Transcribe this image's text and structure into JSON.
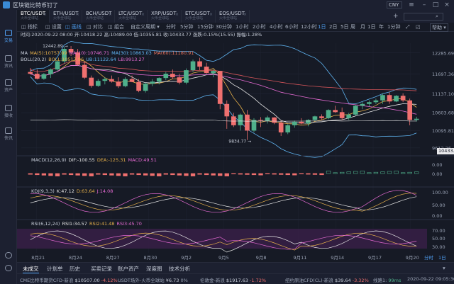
{
  "app": {
    "title": "区块链比特币钉了",
    "currency": "CNY"
  },
  "sidebar": {
    "items": [
      {
        "label": "交易",
        "icon": "trade-icon"
      },
      {
        "label": "资讯",
        "icon": "news-icon"
      },
      {
        "label": "资产",
        "icon": "asset-icon"
      },
      {
        "label": "接收",
        "icon": "receive-icon"
      },
      {
        "label": "快讯",
        "icon": "flash-icon"
      }
    ]
  },
  "pair_tabs": [
    {
      "pair": "BTC/USDT",
      "sub": "火币全球站"
    },
    {
      "pair": "ETH/USDT",
      "sub": "火币全球站"
    },
    {
      "pair": "BCH/USDT",
      "sub": "火币全球站"
    },
    {
      "pair": "LTC/USDT",
      "sub": "火币全球站"
    },
    {
      "pair": "XRP/USDT",
      "sub": "火币全球站"
    },
    {
      "pair": "ETC/USDT",
      "sub": "火币全球站"
    },
    {
      "pair": "EOS/USDT",
      "sub": "火币全球站"
    }
  ],
  "toolbar": {
    "tools": [
      "指标",
      "设置",
      "画线",
      "对比",
      "组合",
      "自定义周期"
    ],
    "periods": [
      "分时",
      "5分钟",
      "15分钟",
      "30分钟",
      "1小时",
      "2小时",
      "4小时",
      "6小时",
      "12小时",
      "1日",
      "2日",
      "5日",
      "周",
      "月",
      "1日",
      "年",
      "1分钟"
    ],
    "active_period": "1日",
    "help": "帮助"
  },
  "chart_data": {
    "type": "candlestick",
    "ohlc_text": "时间:2020-09-22 08:00  开:10418.22  高:10489.00  低:10355.81  收:10433.77  涨跌:0.15%(15.55)  振幅:1.28%",
    "ma_legend": [
      "MA",
      "MA(5):10757.09",
      "MA(10):10746.71",
      "MA(30):10863.03",
      "MA(60):11180.91"
    ],
    "boll_legend": [
      "BOLL(20,2)",
      "BOLL:10517.96",
      "UB:11122.64",
      "LB:9913.27"
    ],
    "y_ticks": [
      "12285.69",
      "11697.36",
      "11137.10",
      "10603.68",
      "10095.81",
      "9612.26"
    ],
    "last_price": "10433.77",
    "high_label": "12442.89",
    "low_label": "9834.77",
    "x_labels": [
      "8月21",
      "8月24",
      "8月27",
      "8月30",
      "9月2",
      "9月5",
      "9月8",
      "9月11",
      "9月14",
      "9月17",
      "9月20"
    ],
    "candles": [
      [
        11750,
        11860,
        11680,
        11700
      ],
      [
        11700,
        11820,
        11540,
        11560
      ],
      [
        11560,
        11720,
        11530,
        11690
      ],
      [
        11690,
        11850,
        11580,
        11820
      ],
      [
        11820,
        12090,
        11780,
        12050
      ],
      [
        12050,
        12460,
        11990,
        12400
      ],
      [
        12400,
        12480,
        12200,
        12300
      ],
      [
        12300,
        12400,
        11920,
        11950
      ],
      [
        11950,
        12050,
        11550,
        11590
      ],
      [
        11590,
        11650,
        11310,
        11360
      ],
      [
        11360,
        11550,
        11330,
        11500
      ],
      [
        11500,
        11600,
        11400,
        11550
      ],
      [
        11550,
        11650,
        11450,
        11480
      ],
      [
        11480,
        11600,
        11300,
        11350
      ],
      [
        11350,
        11600,
        11320,
        11550
      ],
      [
        11550,
        11650,
        11460,
        11470
      ],
      [
        11470,
        11550,
        11180,
        11220
      ],
      [
        11220,
        11450,
        11170,
        11420
      ],
      [
        11420,
        11550,
        11350,
        11480
      ],
      [
        11480,
        11600,
        11400,
        11580
      ],
      [
        11580,
        11750,
        11520,
        11700
      ],
      [
        11700,
        11820,
        11550,
        11600
      ],
      [
        11600,
        11700,
        11400,
        11450
      ],
      [
        11450,
        11850,
        11400,
        11800
      ],
      [
        11800,
        12100,
        11750,
        12050
      ],
      [
        12050,
        12150,
        11800,
        11900
      ],
      [
        11900,
        12010,
        11700,
        11720
      ],
      [
        11720,
        11820,
        11600,
        11780
      ],
      [
        11780,
        11780,
        10700,
        10850
      ],
      [
        10850,
        10950,
        10150,
        10500
      ],
      [
        10500,
        10600,
        10200,
        10250
      ],
      [
        10250,
        10580,
        10100,
        10550
      ],
      [
        10550,
        10680,
        9834,
        10100
      ],
      [
        10100,
        10450,
        10050,
        10400
      ],
      [
        10400,
        10480,
        10200,
        10380
      ],
      [
        10380,
        10520,
        10300,
        10470
      ],
      [
        10470,
        10480,
        10280,
        10320
      ],
      [
        10320,
        10380,
        9950,
        10050
      ],
      [
        10050,
        10280,
        10000,
        10250
      ],
      [
        10250,
        10380,
        10180,
        10350
      ],
      [
        10350,
        10450,
        10280,
        10300
      ],
      [
        10300,
        10420,
        10220,
        10400
      ],
      [
        10400,
        10520,
        10380,
        10500
      ],
      [
        10500,
        10560,
        10400,
        10450
      ],
      [
        10450,
        10700,
        10420,
        10680
      ],
      [
        10680,
        10800,
        10600,
        10620
      ],
      [
        10620,
        10750,
        10400,
        10450
      ],
      [
        10450,
        10600,
        10400,
        10550
      ],
      [
        10550,
        10830,
        10520,
        10800
      ],
      [
        10800,
        10900,
        10700,
        10850
      ],
      [
        10850,
        10950,
        10780,
        10900
      ],
      [
        10900,
        11000,
        10850,
        10950
      ],
      [
        10950,
        11150,
        10850,
        11100
      ],
      [
        11100,
        11180,
        10850,
        10920
      ],
      [
        10920,
        11100,
        10900,
        11080
      ],
      [
        11080,
        11150,
        10900,
        10950
      ],
      [
        10950,
        11000,
        10250,
        10400
      ],
      [
        10400,
        10490,
        10355,
        10433
      ]
    ],
    "macd_legend": [
      "MACD(12,26,9)",
      "DIF:-100.55",
      "DEA:-125.31",
      "MACD:49.51"
    ],
    "macd_ticks": [
      "0.00",
      "0.00"
    ],
    "kdj_legend": [
      "KDJ(9,3,3)",
      "K:47.12",
      "D:63.64",
      "J:14.08"
    ],
    "kdj_ticks": [
      "100.00",
      "50.00",
      "0.00"
    ],
    "rsi_legend": [
      "RSI(6,12,24)",
      "RSI1:34.57",
      "RSI2:41.48",
      "RSI3:45.70"
    ],
    "rsi_ticks": [
      "70.00",
      "50.00",
      "30.00"
    ]
  },
  "bottom_tabs": [
    "未成交",
    "计划单",
    "历史",
    "买卖记录",
    "账户资产",
    "深度图",
    "技术分析"
  ],
  "right_labels": [
    "分时",
    "1日"
  ],
  "ticker": [
    {
      "name": "CME比特币期货CFD-新浪",
      "price": "$10507.00",
      "change": "-4.12%"
    },
    {
      "name": "USDT场外-火币全球站",
      "price": "¥6.73",
      "change": "0%"
    },
    {
      "name": "伦敦金-新浪",
      "price": "$1917.63",
      "change": "-1.72%"
    },
    {
      "name": "纽约原油CFD(CL)-新浪",
      "price": "$39.64",
      "change": "-3.32%"
    }
  ],
  "status": {
    "latency_label": "线路1:",
    "latency": "99ms",
    "time": "2020-09-22 09:05:30"
  },
  "colors": {
    "up": "#4fb08b",
    "down": "#f0706f",
    "bg": "#161a25",
    "accent": "#4f9df0"
  }
}
